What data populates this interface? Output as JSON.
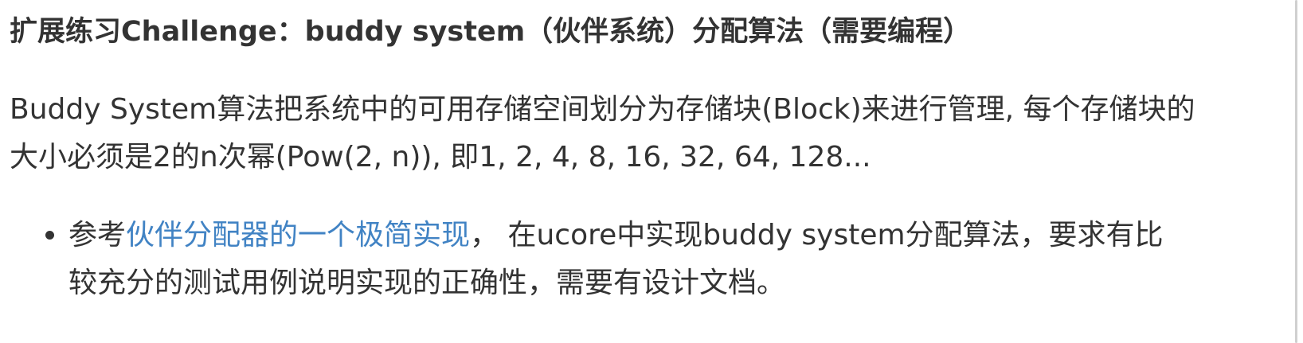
{
  "heading": {
    "text": "扩展练习Challenge：buddy system（伙伴系统）分配算法（需要编程）"
  },
  "paragraph": {
    "line1": "Buddy System算法把系统中的可用存储空间划分为存储块(Block)来进行管理, 每个存储块的",
    "line2": "大小必须是2的n次幂(Pow(2, n)), 即1, 2, 4, 8, 16, 32, 64, 128..."
  },
  "bullet": {
    "prefix": "参考",
    "link_text": "伙伴分配器的一个极简实现",
    "rest_line1": "， 在ucore中实现buddy system分配算法，要求有比",
    "line2": "较充分的测试用例说明实现的正确性，需要有设计文档。"
  },
  "colors": {
    "text": "#333333",
    "link": "#4183c4",
    "background": "#ffffff"
  }
}
